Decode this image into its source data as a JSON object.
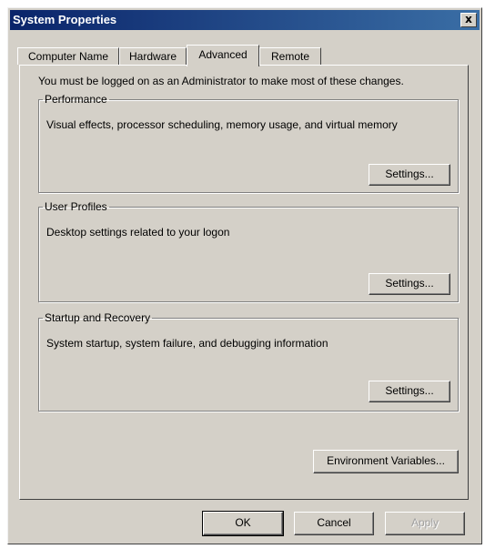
{
  "window": {
    "title": "System Properties",
    "close_label": "x"
  },
  "tabs": [
    {
      "label": "Computer Name",
      "active": false
    },
    {
      "label": "Hardware",
      "active": false
    },
    {
      "label": "Advanced",
      "active": true
    },
    {
      "label": "Remote",
      "active": false
    }
  ],
  "intro_text": "You must be logged on as an Administrator to make most of these changes.",
  "groups": {
    "performance": {
      "title": "Performance",
      "description": "Visual effects, processor scheduling, memory usage, and virtual memory",
      "button": "Settings..."
    },
    "user_profiles": {
      "title": "User Profiles",
      "description": "Desktop settings related to your logon",
      "button": "Settings..."
    },
    "startup_recovery": {
      "title": "Startup and Recovery",
      "description": "System startup, system failure, and debugging information",
      "button": "Settings..."
    }
  },
  "environment_button": "Environment Variables...",
  "footer": {
    "ok": "OK",
    "cancel": "Cancel",
    "apply": "Apply",
    "apply_enabled": false
  }
}
